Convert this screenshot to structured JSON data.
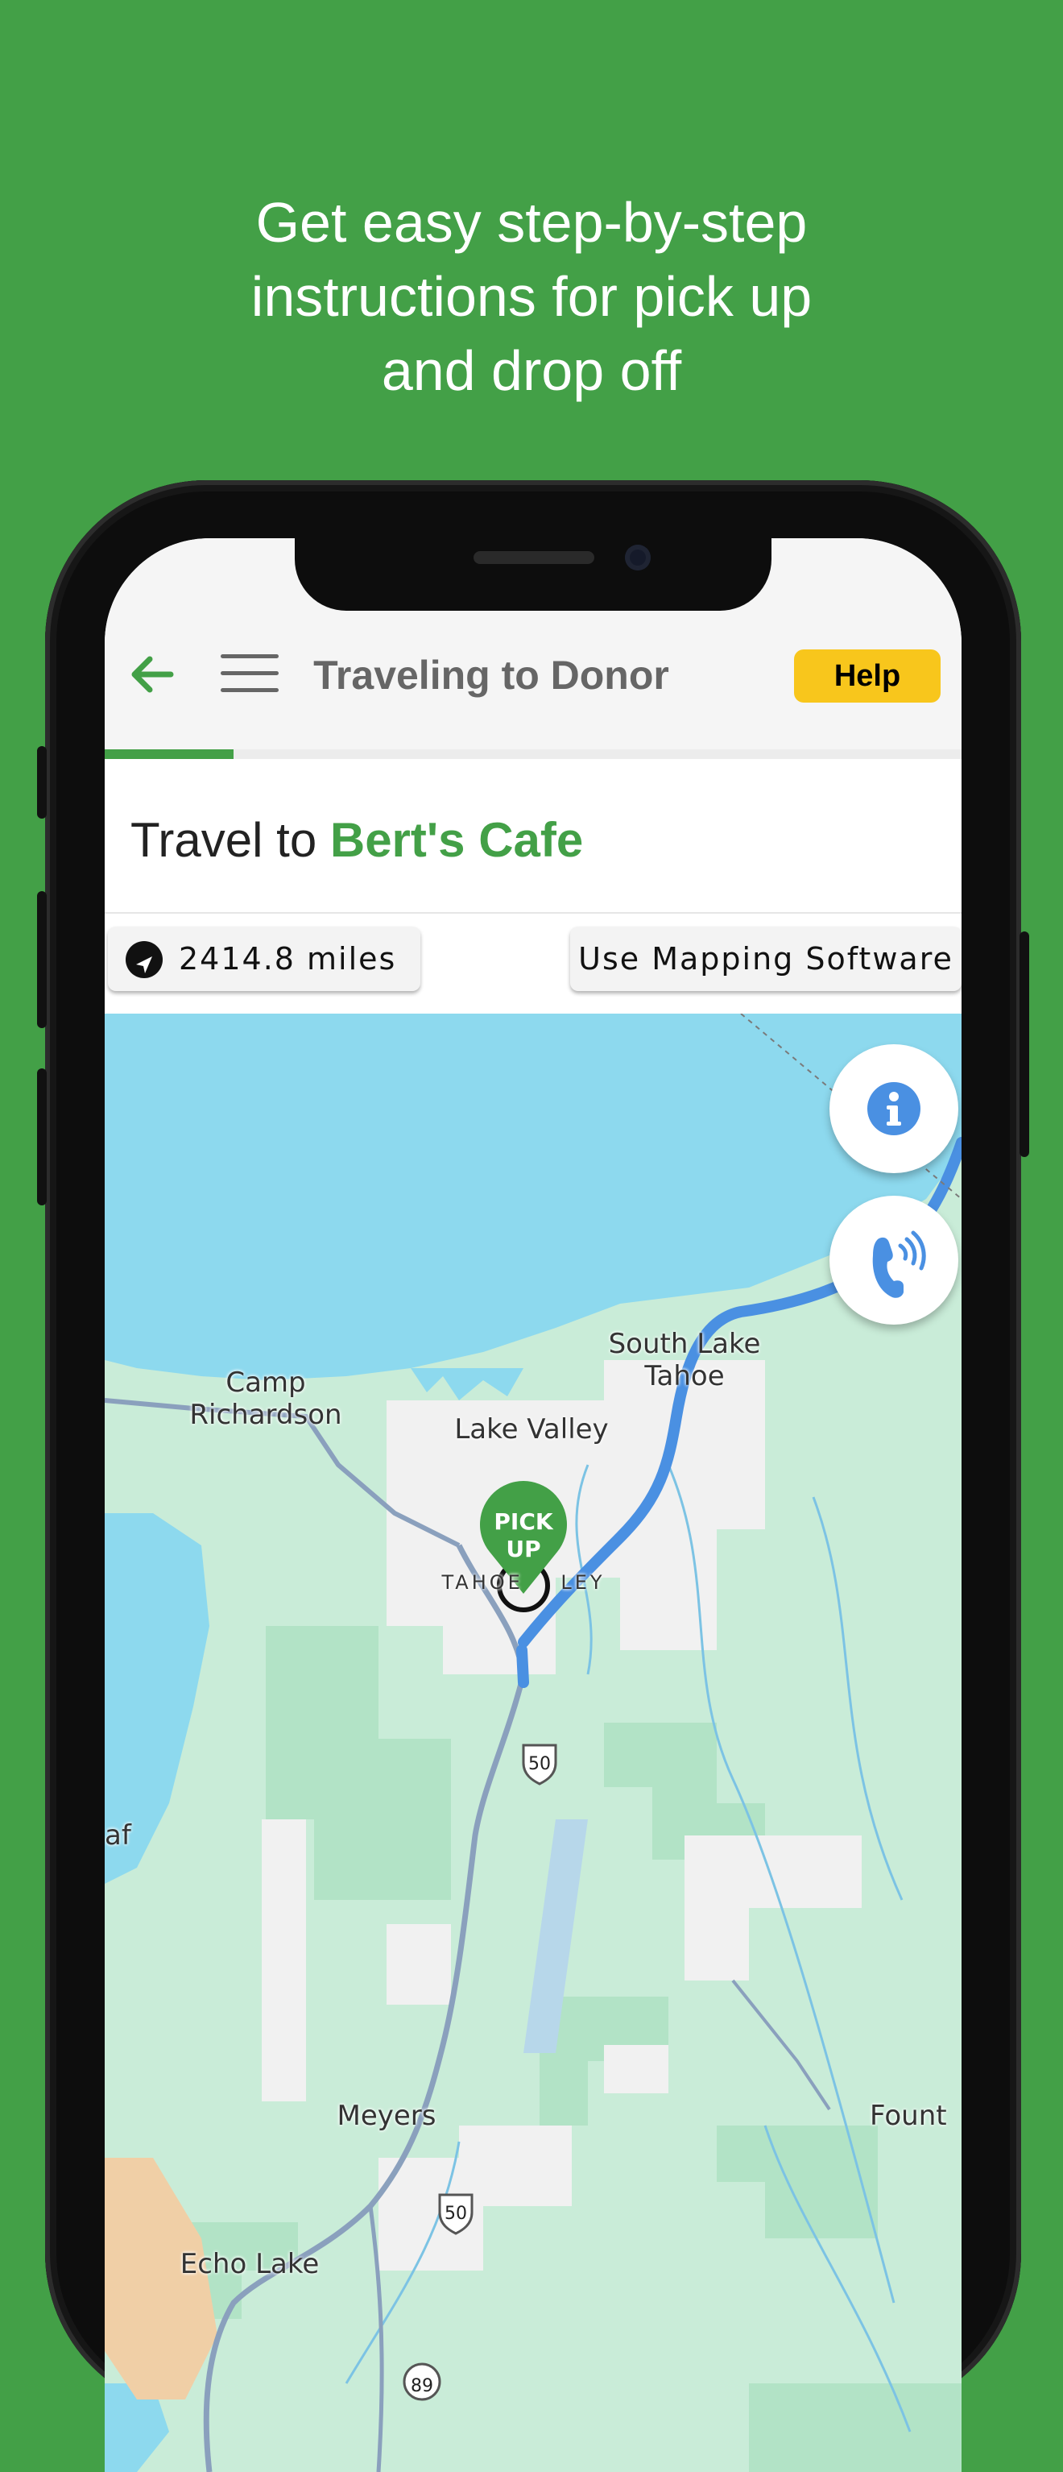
{
  "headline": {
    "line1": "Get easy step-by-step",
    "line2": "instructions for pick up",
    "line3": "and drop off"
  },
  "header": {
    "title": "Traveling to Donor",
    "help_label": "Help",
    "progress": 0.15
  },
  "travel": {
    "prefix": "Travel to",
    "place": "Bert's Cafe"
  },
  "chips": {
    "distance": "2414.8 miles",
    "mapping": "Use Mapping Software"
  },
  "map": {
    "labels": {
      "south_lake_tahoe": "South Lake\nTahoe",
      "camp_richardson": "Camp\nRichardson",
      "lake_valley": "Lake Valley",
      "tahoe_valley": "TAHOE    LEY",
      "meyers": "Meyers",
      "echo_lake": "Echo Lake",
      "fount": "Fount",
      "af": "af",
      "route_50_a": "50",
      "route_50_b": "50",
      "route_89": "89"
    },
    "marker_label": "PICK\nUP"
  },
  "icons": {
    "back": "arrow-left-icon",
    "menu": "hamburger-menu-icon",
    "navigation": "navigation-arrow-icon",
    "info": "info-icon",
    "phone": "phone-call-icon"
  },
  "colors": {
    "brand_green": "#43a047",
    "help_yellow": "#f8c61c",
    "water": "#8dd9ee",
    "route_blue": "#4a90e2"
  }
}
